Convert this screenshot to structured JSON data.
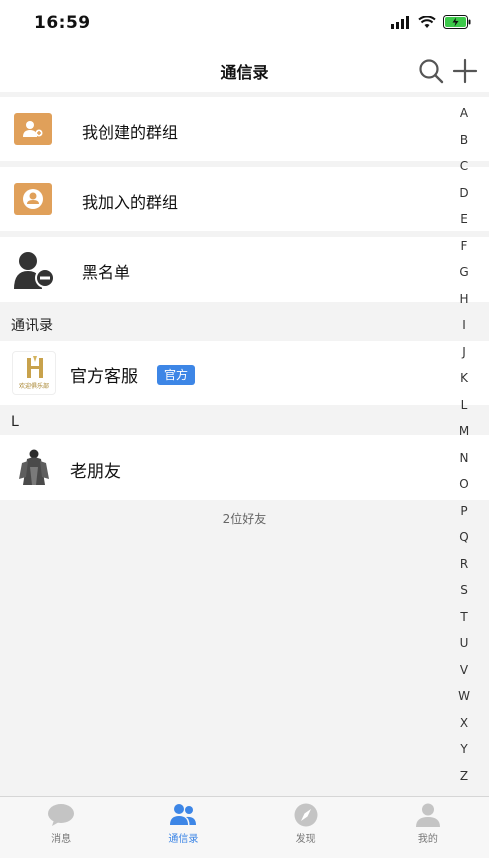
{
  "status": {
    "time": "16:59"
  },
  "nav": {
    "title": "通信录"
  },
  "groups": [
    {
      "label": "我创建的群组",
      "icon": "create-group-icon"
    },
    {
      "label": "我加入的群组",
      "icon": "join-group-icon"
    },
    {
      "label": "黑名单",
      "icon": "blacklist-icon"
    }
  ],
  "contacts_header": "通讯录",
  "official": {
    "name": "官方客服",
    "badge": "官方",
    "avatar_text": "欢迎俱乐部"
  },
  "letter_section": "L",
  "friend": {
    "name": "老朋友"
  },
  "friend_count": "2位好友",
  "index": [
    "A",
    "B",
    "C",
    "D",
    "E",
    "F",
    "G",
    "H",
    "I",
    "J",
    "K",
    "L",
    "M",
    "N",
    "O",
    "P",
    "Q",
    "R",
    "S",
    "T",
    "U",
    "V",
    "W",
    "X",
    "Y",
    "Z"
  ],
  "tabs": [
    {
      "label": "消息",
      "icon": "message-icon",
      "active": false
    },
    {
      "label": "通信录",
      "icon": "contacts-icon",
      "active": true
    },
    {
      "label": "发现",
      "icon": "compass-icon",
      "active": false
    },
    {
      "label": "我的",
      "icon": "profile-icon",
      "active": false
    }
  ],
  "colors": {
    "accent": "#3d86e6",
    "group_icon": "#e0a05a",
    "background": "#f3f3f3"
  }
}
